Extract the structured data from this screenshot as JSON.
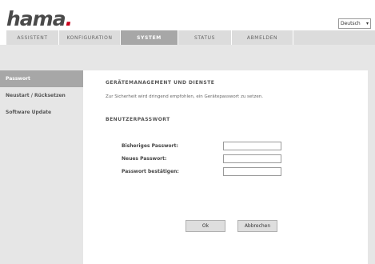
{
  "brand": {
    "logo_text": "hama",
    "logo_dot": "."
  },
  "language": {
    "selected": "Deutsch"
  },
  "nav": {
    "tabs": [
      {
        "label": "ASSISTENT"
      },
      {
        "label": "KONFIGURATION"
      },
      {
        "label": "SYSTEM"
      },
      {
        "label": "STATUS"
      },
      {
        "label": "ABMELDEN"
      }
    ],
    "active_index": 2
  },
  "sidebar": {
    "items": [
      {
        "label": "Passwort"
      },
      {
        "label": "Neustart / Rücksetzen"
      },
      {
        "label": "Software Update"
      }
    ],
    "active_index": 0
  },
  "main": {
    "section1_title": "GERÄTEMANAGEMENT UND DIENSTE",
    "hint": "Zur Sicherheit wird dringend empfohlen, ein Gerätepasswort zu setzen.",
    "section2_title": "BENUTZERPASSWORT",
    "fields": [
      {
        "label": "Bisheriges Passwort:",
        "value": ""
      },
      {
        "label": "Neues Passwort:",
        "value": ""
      },
      {
        "label": "Passwort bestätigen:",
        "value": ""
      }
    ],
    "ok_label": "Ok",
    "cancel_label": "Abbrechen"
  },
  "colors": {
    "accent_red": "#c9001a",
    "tab_active": "#a7a7a7",
    "tab_inactive": "#dcdcdc",
    "background_band": "#e6e6e6"
  }
}
